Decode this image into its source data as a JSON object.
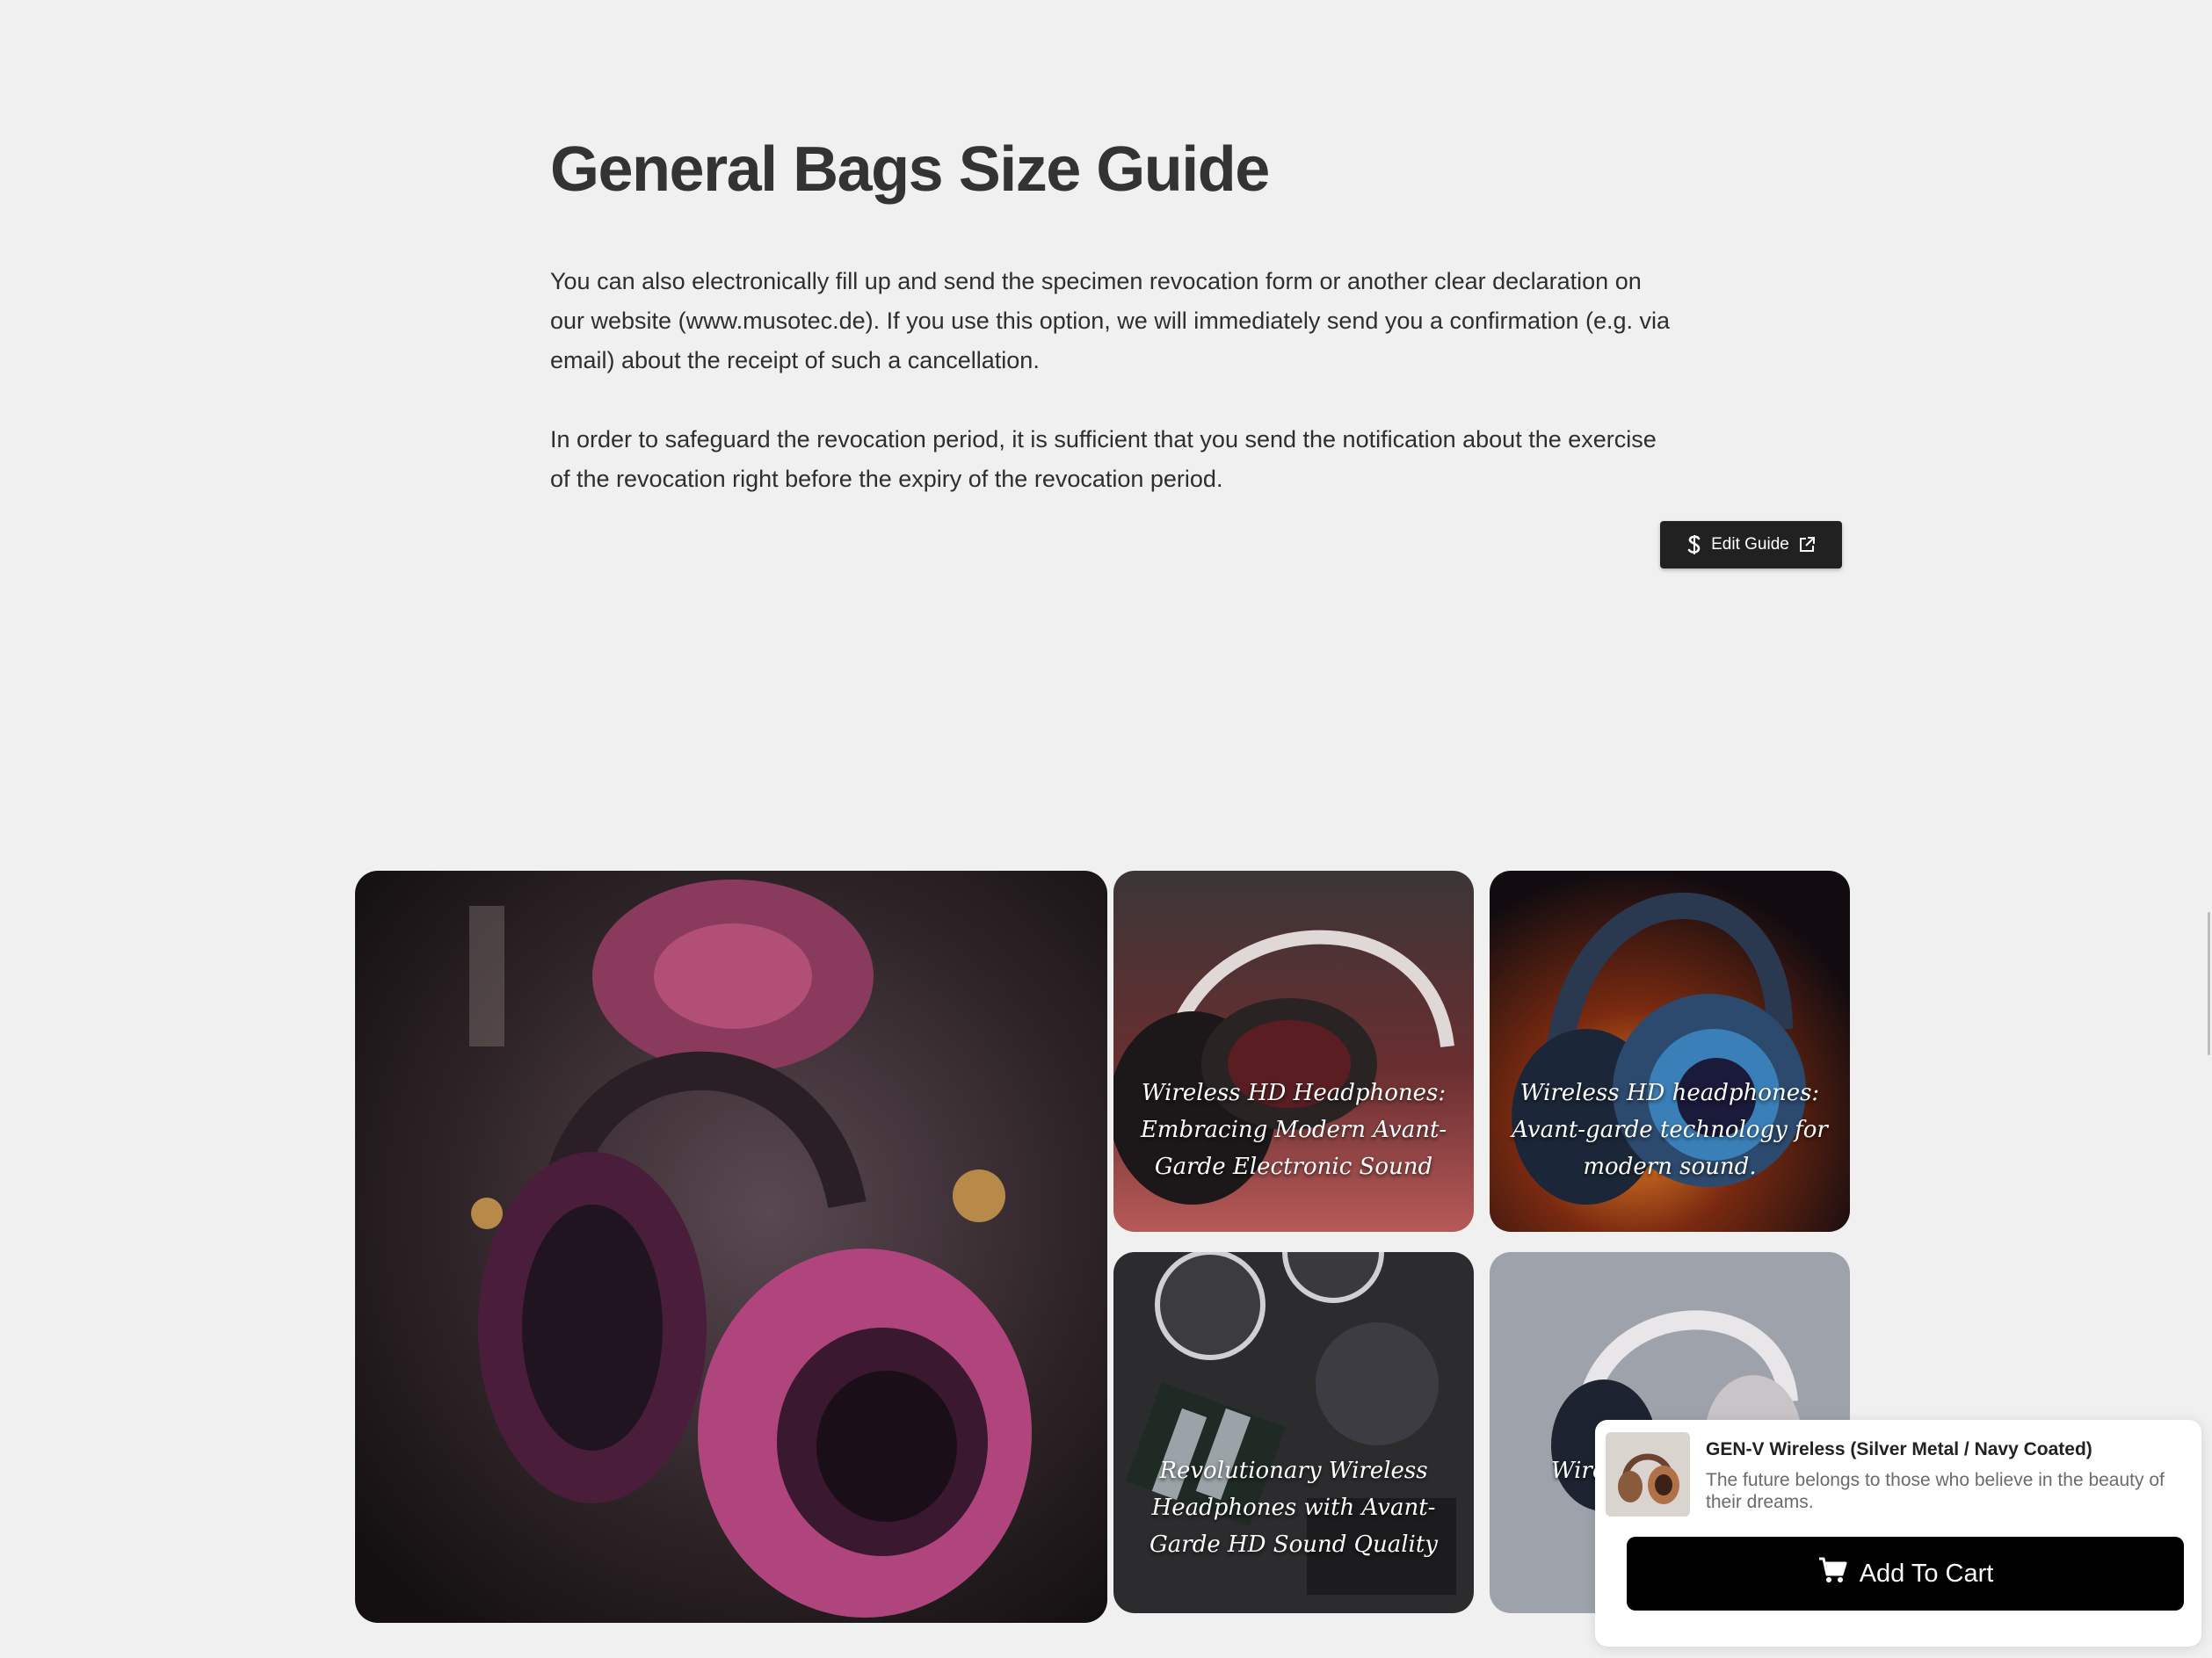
{
  "guide": {
    "title": "General Bags Size Guide",
    "paragraph_1": "You can also electronically fill up and send the specimen revocation form or another clear declaration on our website (www.musotec.de). If you use this option, we will immediately send you a confirmation (e.g. via email) about the receipt of such a cancellation.",
    "paragraph_2": "In order to safeguard the revocation period, it is sufficient that you send the notification about the exercise of the revocation right before the expiry of the revocation period.",
    "edit_button_label": "Edit Guide",
    "edit_button_icons": [
      "shopify-s-icon",
      "external-link-icon"
    ]
  },
  "gallery": {
    "tiles": [
      {
        "caption": ""
      },
      {
        "caption": "Wireless HD Headphones: Embracing Modern Avant-Garde Electronic Sound"
      },
      {
        "caption": "Wireless HD headphones: Avant-garde technology for modern sound."
      },
      {
        "caption": "Revolutionary Wireless Headphones with Avant-Garde HD Sound Quality"
      },
      {
        "caption": "Wirele... Mode... E..."
      }
    ]
  },
  "sticky_cart": {
    "product_title": "GEN-V Wireless (Silver Metal / Navy Coated)",
    "product_description": "The future belongs to those who believe in the beauty of their dreams.",
    "button_label": "Add To Cart",
    "button_icon": "cart-icon"
  },
  "colors": {
    "background": "#f0f0f0",
    "button_dark": "#212121",
    "cart_button": "#000000"
  }
}
